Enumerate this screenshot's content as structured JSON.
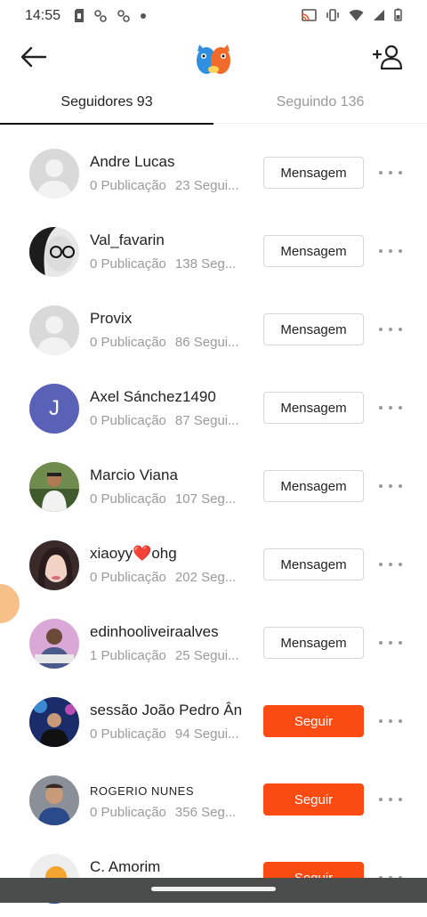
{
  "status": {
    "time": "14:55"
  },
  "tabs": [
    {
      "label": "Seguidores 93",
      "active": true
    },
    {
      "label": "Seguindo 136",
      "active": false
    }
  ],
  "colors": {
    "accent": "#fa4c12"
  },
  "users": [
    {
      "name": "Andre Lucas",
      "posts": "0 Publicação",
      "followers": "23 Segui...",
      "action": "Mensagem",
      "action_type": "message",
      "avatar": "default-avatar"
    },
    {
      "name": "Val_favarin",
      "posts": "0 Publicação",
      "followers": "138 Seg...",
      "action": "Mensagem",
      "action_type": "message",
      "avatar": "photo-avatar"
    },
    {
      "name": "Provix",
      "posts": "0 Publicação",
      "followers": "86 Segui...",
      "action": "Mensagem",
      "action_type": "message",
      "avatar": "default-avatar"
    },
    {
      "name": "Axel Sánchez1490",
      "posts": "0 Publicação",
      "followers": "87 Segui...",
      "action": "Mensagem",
      "action_type": "message",
      "avatar": "letter-avatar",
      "initial": "J"
    },
    {
      "name": "Marcio Viana",
      "posts": "0 Publicação",
      "followers": "107 Seg...",
      "action": "Mensagem",
      "action_type": "message",
      "avatar": "photo-avatar"
    },
    {
      "name": "xiaoyy❤️ohg",
      "posts": "0 Publicação",
      "followers": "202 Seg...",
      "action": "Mensagem",
      "action_type": "message",
      "avatar": "photo-avatar"
    },
    {
      "name": "edinhooliveiraalves",
      "posts": "1 Publicação",
      "followers": "25 Segui...",
      "action": "Mensagem",
      "action_type": "message",
      "avatar": "photo-avatar"
    },
    {
      "name": "sessão João Pedro Ân",
      "posts": "0 Publicação",
      "followers": "94 Segui...",
      "action": "Seguir",
      "action_type": "follow",
      "avatar": "photo-avatar"
    },
    {
      "name": "ROGERIO NUNES",
      "posts": "0 Publicação",
      "followers": "356 Seg...",
      "action": "Seguir",
      "action_type": "follow",
      "avatar": "photo-avatar"
    },
    {
      "name": "C. Amorim",
      "posts": "",
      "followers": "",
      "action": "Seguir",
      "action_type": "follow",
      "avatar": "photo-avatar"
    }
  ]
}
